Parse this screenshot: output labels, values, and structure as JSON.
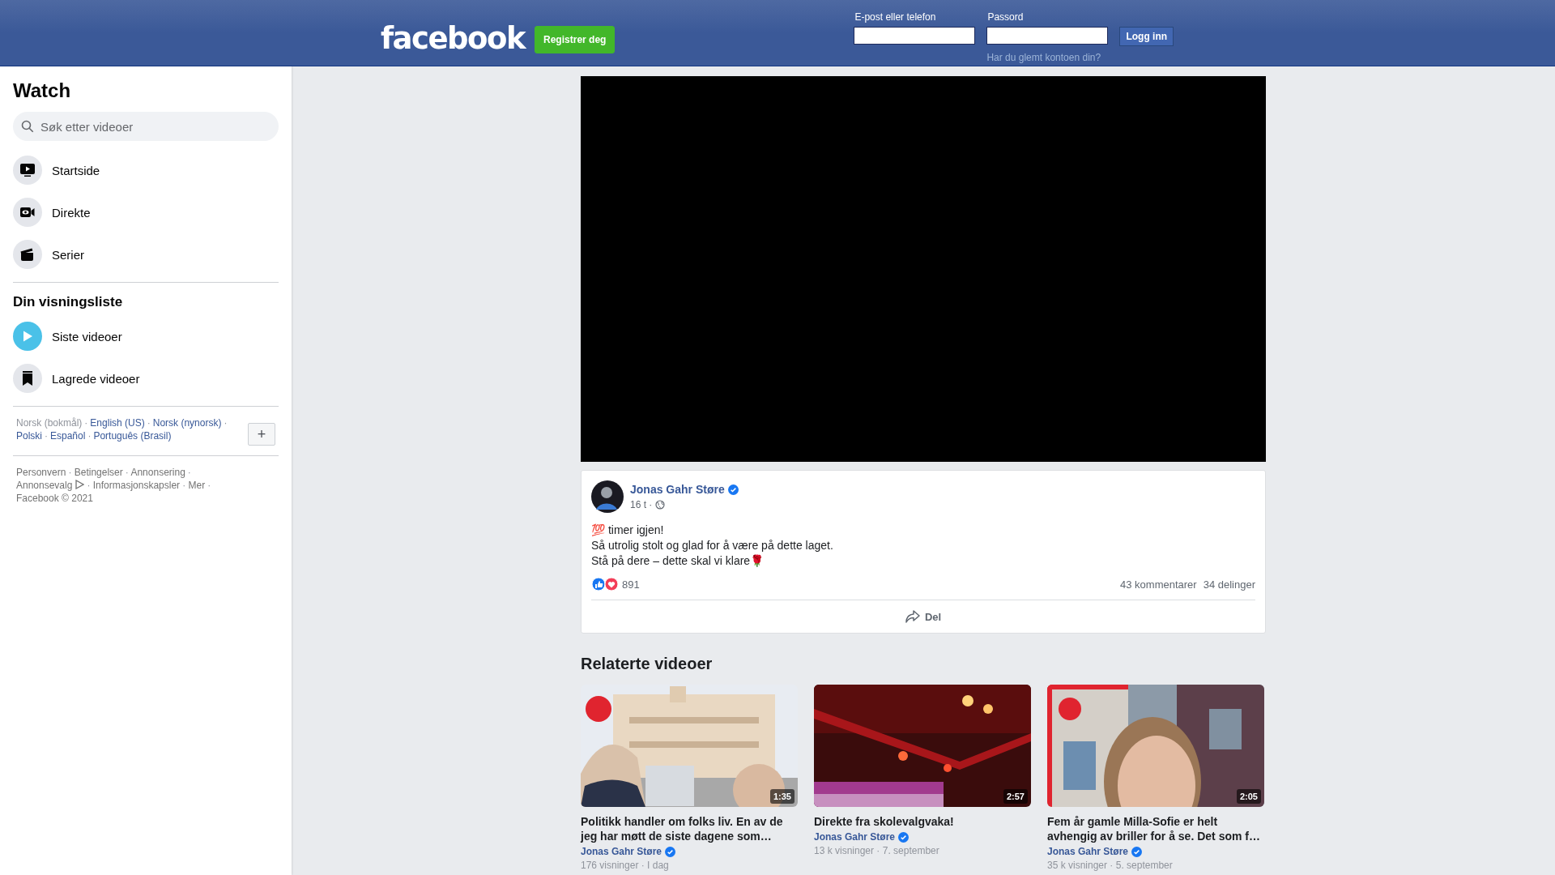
{
  "header": {
    "logo": "facebook",
    "register_button": "Registrer deg",
    "email": {
      "label": "E-post eller telefon"
    },
    "password": {
      "label": "Passord"
    },
    "login_button": "Logg inn",
    "forgot_link": "Har du glemt kontoen din?"
  },
  "sidebar": {
    "title": "Watch",
    "search": {
      "placeholder": "Søk etter videoer"
    },
    "nav": [
      {
        "kind": "tv",
        "label": "Startside"
      },
      {
        "kind": "live",
        "label": "Direkte"
      },
      {
        "kind": "clapper",
        "label": "Serier"
      }
    ],
    "watchlist_title": "Din visningsliste",
    "watchlist": [
      {
        "kind": "play",
        "label": "Siste videoer"
      },
      {
        "kind": "bookmark",
        "label": "Lagrede videoer"
      }
    ],
    "separator": "·",
    "languages": [
      {
        "label": "Norsk (bokmål)",
        "selected": true
      },
      {
        "label": "English (US)",
        "selected": false
      },
      {
        "label": "Norsk (nynorsk)",
        "selected": false
      },
      {
        "label": "Polski",
        "selected": false
      },
      {
        "label": "Español",
        "selected": false
      },
      {
        "label": "Português (Brasil)",
        "selected": false
      }
    ],
    "add_language_button": "+",
    "footer_links": [
      {
        "label": "Personvern"
      },
      {
        "label": "Betingelser"
      },
      {
        "label": "Annonsering"
      },
      {
        "label": "Annonsevalg",
        "kind": "adchoices"
      },
      {
        "label": "Informasjonskapsler"
      },
      {
        "label": "Mer"
      }
    ],
    "copyright": "Facebook © 2021"
  },
  "post": {
    "author": "Jonas Gahr Støre",
    "verified": true,
    "time": "16 t ·",
    "lines": [
      "💯 timer igjen!",
      "Så utrolig stolt og glad for å være på dette laget.",
      "Stå på dere – dette skal vi klare🌹"
    ],
    "reactions_count": "891",
    "comments": "43 kommentarer",
    "shares": "34 delinger",
    "share_button": "Del"
  },
  "related": {
    "title": "Relaterte videoer",
    "videos": [
      {
        "duration": "1:35",
        "title": " Politikk handler om folks liv. En av de jeg har møtt de siste dagene som…",
        "author": "Jonas Gahr Støre",
        "verified": true,
        "meta": "176 visninger · I dag",
        "kind": "square"
      },
      {
        "duration": "2:57",
        "title": "Direkte fra skolevalgvaka!",
        "author": "Jonas Gahr Støre",
        "verified": true,
        "meta": "13 k visninger · 7. september",
        "kind": "stage"
      },
      {
        "duration": "2:05",
        "title": "Fem år gamle Milla-Sofie er helt avhengig av briller for å se. Det som f…",
        "author": "Jonas Gahr Støre",
        "verified": true,
        "meta": "35 k visninger · 5. september",
        "kind": "street"
      }
    ]
  }
}
